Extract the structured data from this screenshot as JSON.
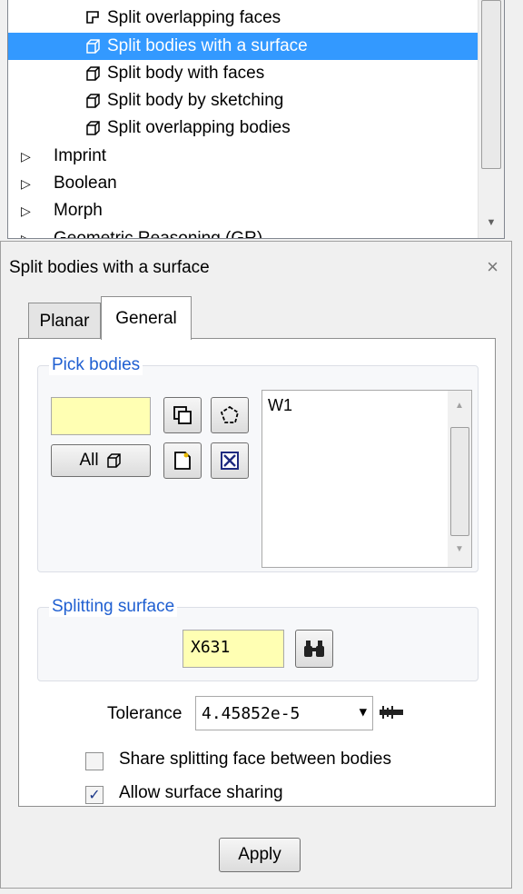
{
  "tree": {
    "items": [
      {
        "label": "Split overlapping faces",
        "icon": "face-split-icon"
      },
      {
        "label": "Split bodies with a surface",
        "icon": "body-icon",
        "selected": true
      },
      {
        "label": "Split body with faces",
        "icon": "body-icon"
      },
      {
        "label": "Split body by sketching",
        "icon": "body-icon"
      },
      {
        "label": "Split overlapping bodies",
        "icon": "body-icon"
      }
    ],
    "groups": [
      {
        "label": "Imprint"
      },
      {
        "label": "Boolean"
      },
      {
        "label": "Morph"
      },
      {
        "label": "Geometric Reasoning (GR)"
      }
    ]
  },
  "dialog": {
    "title": "Split bodies with a surface",
    "close": "×",
    "tabs": [
      {
        "label": "Planar"
      },
      {
        "label": "General"
      }
    ],
    "pick_bodies": {
      "title": "Pick bodies",
      "input_value": "",
      "all_label": "All",
      "list_items": [
        "W1"
      ]
    },
    "splitting_surface": {
      "title": "Splitting surface",
      "value": "X631"
    },
    "tolerance": {
      "label": "Tolerance",
      "value": "4.45852e-5"
    },
    "checkboxes": [
      {
        "label": "Share splitting face between bodies",
        "checked": false
      },
      {
        "label": "Allow surface sharing",
        "checked": true
      }
    ],
    "apply_label": "Apply"
  }
}
